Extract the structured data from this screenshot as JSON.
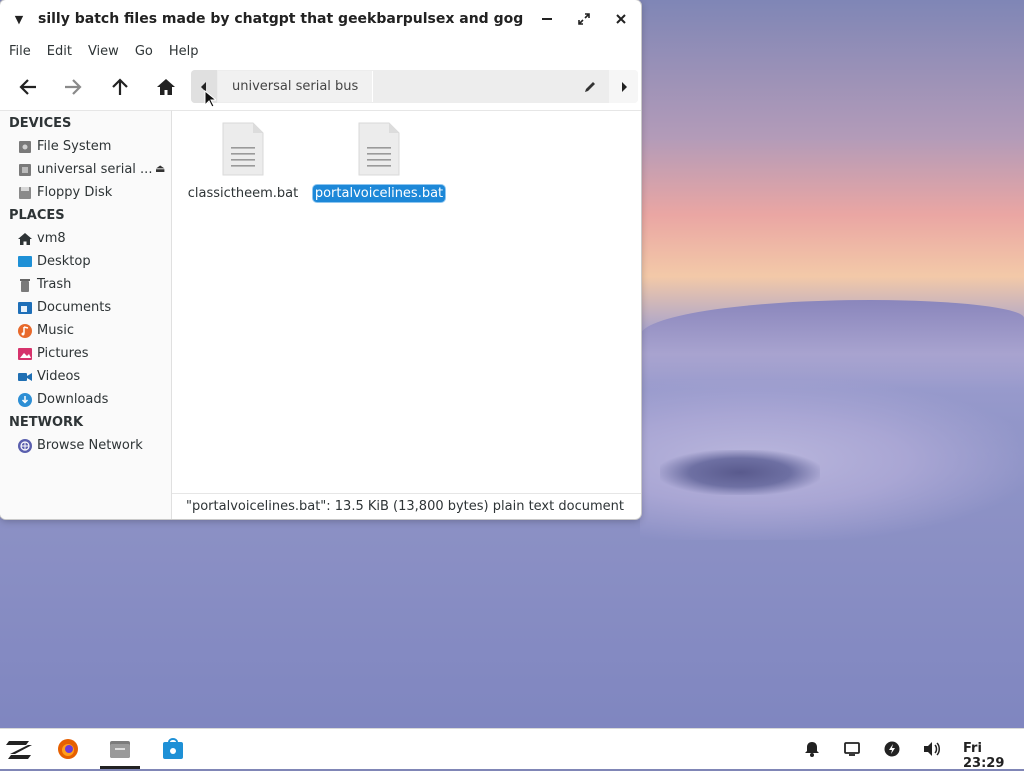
{
  "window": {
    "title": "silly batch files made by chatgpt that geekbarpulsex and gogo hate - File M",
    "menu": [
      "File",
      "Edit",
      "View",
      "Go",
      "Help"
    ],
    "path": {
      "crumb": "universal serial bus"
    }
  },
  "sidebar": {
    "devices_header": "DEVICES",
    "devices": [
      {
        "label": "File System",
        "icon": "drive-icon"
      },
      {
        "label": "universal serial ...",
        "icon": "usb-drive-icon"
      },
      {
        "label": "Floppy Disk",
        "icon": "floppy-icon"
      }
    ],
    "places_header": "PLACES",
    "places": [
      {
        "label": "vm8",
        "icon": "home-icon"
      },
      {
        "label": "Desktop",
        "icon": "desktop-icon"
      },
      {
        "label": "Trash",
        "icon": "trash-icon"
      },
      {
        "label": "Documents",
        "icon": "documents-icon"
      },
      {
        "label": "Music",
        "icon": "music-icon"
      },
      {
        "label": "Pictures",
        "icon": "pictures-icon"
      },
      {
        "label": "Videos",
        "icon": "videos-icon"
      },
      {
        "label": "Downloads",
        "icon": "downloads-icon"
      }
    ],
    "network_header": "NETWORK",
    "network": [
      {
        "label": "Browse Network",
        "icon": "network-icon"
      }
    ]
  },
  "files": [
    {
      "name": "classictheem.bat",
      "selected": false
    },
    {
      "name": "portalvoicelines.bat",
      "selected": true
    }
  ],
  "status": "\"portalvoicelines.bat\": 13.5 KiB (13,800 bytes) plain text document",
  "taskbar": {
    "clock": "Fri 23:29",
    "apps": [
      "zorin-menu-icon",
      "firefox-icon",
      "files-icon",
      "software-store-icon"
    ],
    "tray": [
      "bell-icon",
      "display-icon",
      "power-icon",
      "volume-icon"
    ]
  },
  "colors": {
    "selection": "#1d88d8",
    "folder_blue": "#1e90d6"
  }
}
